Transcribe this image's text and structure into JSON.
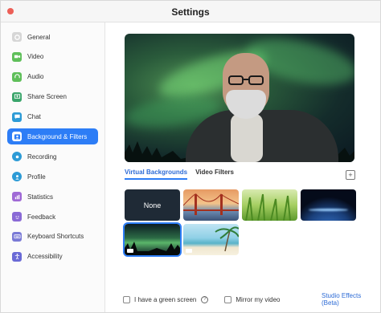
{
  "window": {
    "title": "Settings"
  },
  "sidebar": {
    "items": [
      {
        "label": "General",
        "icon": "gear-icon",
        "color": "#d0d0d0"
      },
      {
        "label": "Video",
        "icon": "video-camera-icon",
        "color": "#5fbf5a"
      },
      {
        "label": "Audio",
        "icon": "headphones-icon",
        "color": "#5fbf5a"
      },
      {
        "label": "Share Screen",
        "icon": "share-screen-icon",
        "color": "#3aa56b"
      },
      {
        "label": "Chat",
        "icon": "chat-bubble-icon",
        "color": "#2d9bd6"
      },
      {
        "label": "Background & Filters",
        "icon": "person-background-icon",
        "color": "#2d7df6"
      },
      {
        "label": "Recording",
        "icon": "record-icon",
        "color": "#2d9bd6"
      },
      {
        "label": "Profile",
        "icon": "profile-icon",
        "color": "#2d9bd6"
      },
      {
        "label": "Statistics",
        "icon": "statistics-icon",
        "color": "#a06ad6"
      },
      {
        "label": "Feedback",
        "icon": "feedback-smiley-icon",
        "color": "#8a6ad6"
      },
      {
        "label": "Keyboard Shortcuts",
        "icon": "keyboard-icon",
        "color": "#7a7ad6"
      },
      {
        "label": "Accessibility",
        "icon": "accessibility-icon",
        "color": "#6a6ad6"
      }
    ],
    "active_index": 5
  },
  "tabs": [
    {
      "label": "Virtual Backgrounds",
      "active": true
    },
    {
      "label": "Video Filters",
      "active": false
    }
  ],
  "backgrounds": [
    {
      "label": "None",
      "kind": "none"
    },
    {
      "label": "",
      "kind": "golden-gate"
    },
    {
      "label": "",
      "kind": "grass"
    },
    {
      "label": "",
      "kind": "earth"
    },
    {
      "label": "",
      "kind": "aurora",
      "selected": true
    },
    {
      "label": "",
      "kind": "beach"
    }
  ],
  "options": {
    "green_screen": {
      "label": "I have a green screen",
      "checked": false
    },
    "mirror": {
      "label": "Mirror my video",
      "checked": false
    },
    "studio_effects": "Studio Effects (Beta)"
  },
  "colors": {
    "accent": "#2d7df6",
    "close_button": "#ec5f57"
  }
}
